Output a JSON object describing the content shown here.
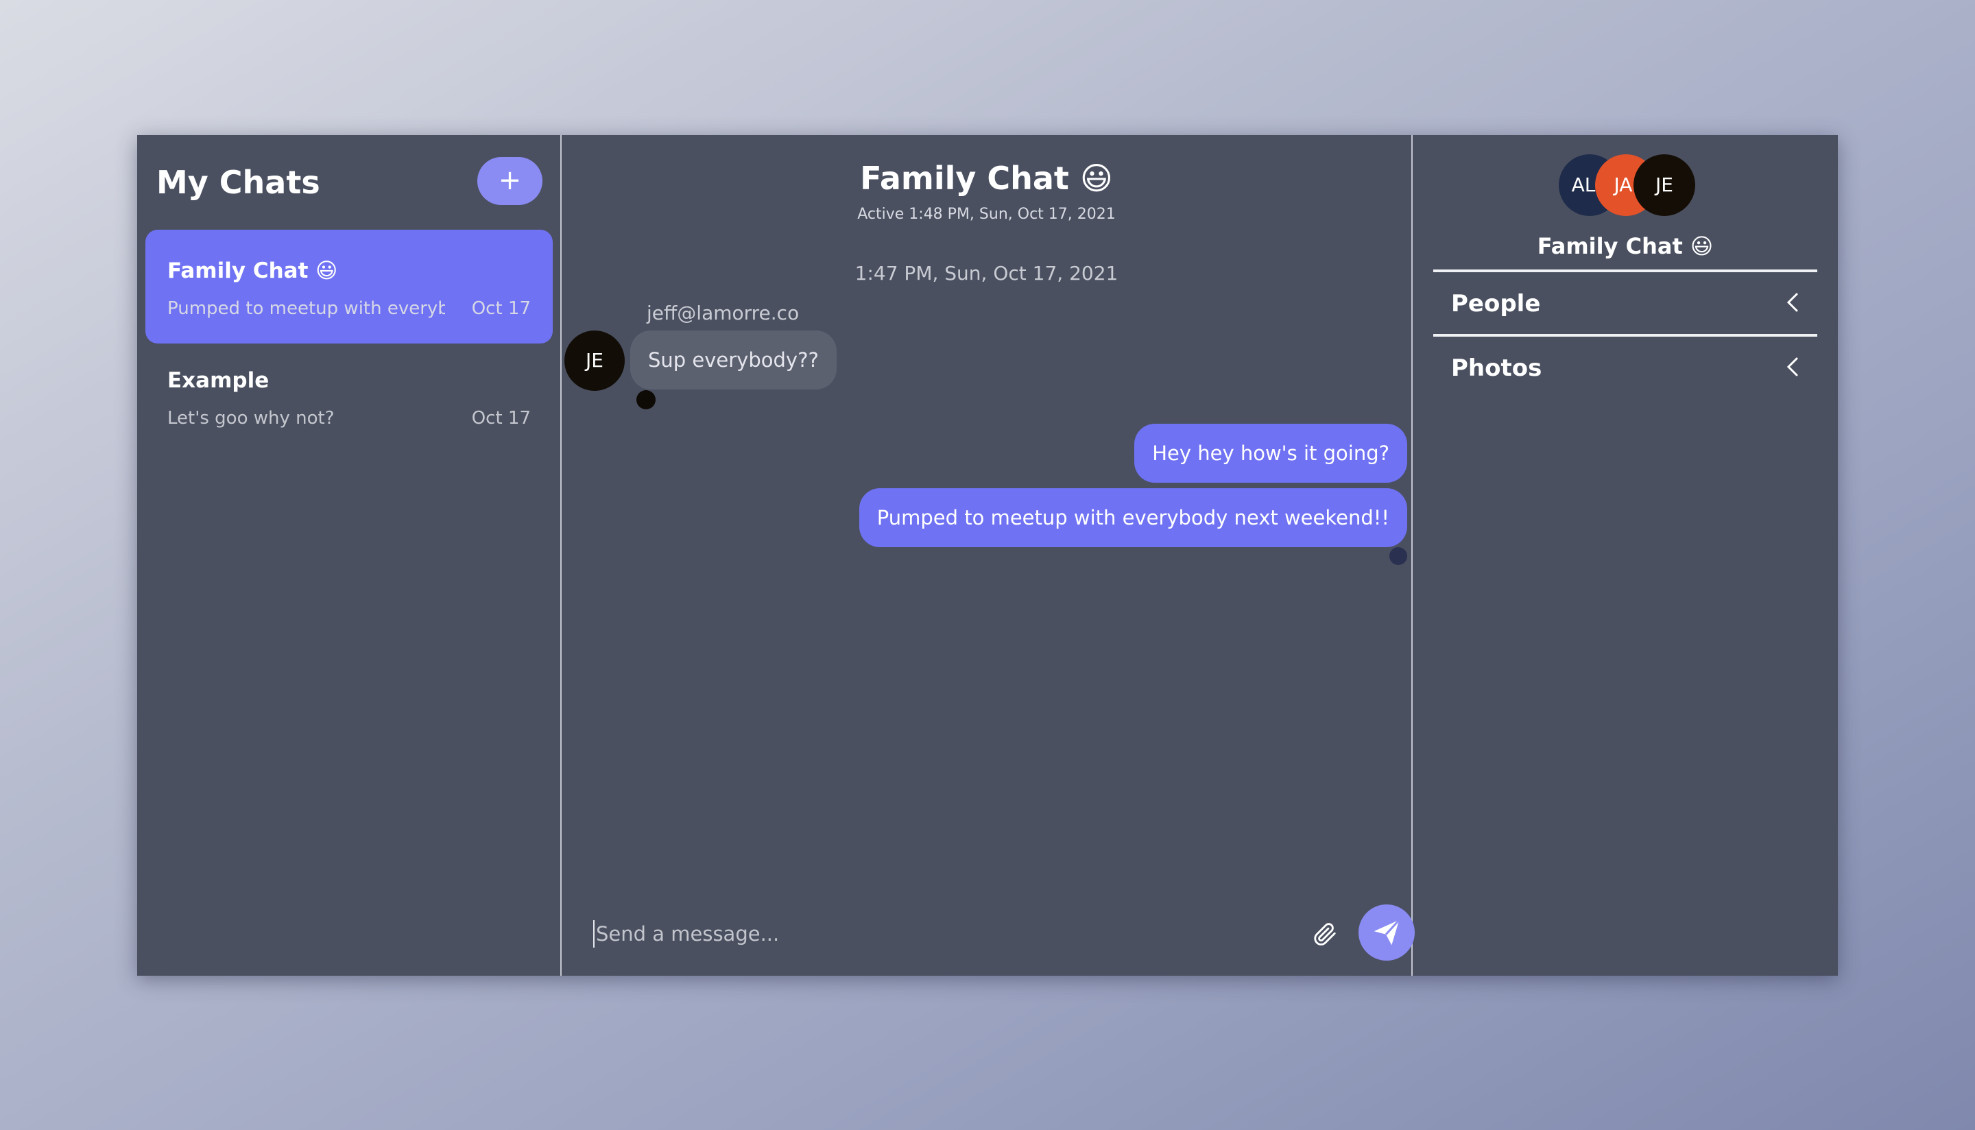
{
  "sidebar": {
    "title": "My Chats",
    "add_label": "+",
    "chats": [
      {
        "name": "Family Chat 😃",
        "preview": "Pumped to meetup with everybody next weekend!!",
        "date": "Oct 17",
        "active": true
      },
      {
        "name": "Example",
        "preview": "Let's goo why not?",
        "date": "Oct 17",
        "active": false
      }
    ]
  },
  "conversation": {
    "title": "Family Chat 😃",
    "subtitle": "Active 1:48 PM, Sun, Oct 17, 2021",
    "timestamp": "1:47 PM, Sun, Oct 17, 2021",
    "incoming": {
      "sender": "jeff@lamorre.co",
      "avatar_initials": "JE",
      "text": "Sup everybody??"
    },
    "outgoing": [
      {
        "text": "Hey hey how's it going?"
      },
      {
        "text": "Pumped to meetup with everybody next weekend!!"
      }
    ],
    "composer": {
      "placeholder": "Send a message...",
      "value": ""
    }
  },
  "details": {
    "avatars": [
      "AL",
      "JA",
      "JE"
    ],
    "title": "Family Chat 😃",
    "sections": [
      {
        "label": "People"
      },
      {
        "label": "Photos"
      }
    ]
  },
  "colors": {
    "accent": "#6f72f2",
    "button": "#8a8cf4",
    "panel": "#4a5060"
  }
}
